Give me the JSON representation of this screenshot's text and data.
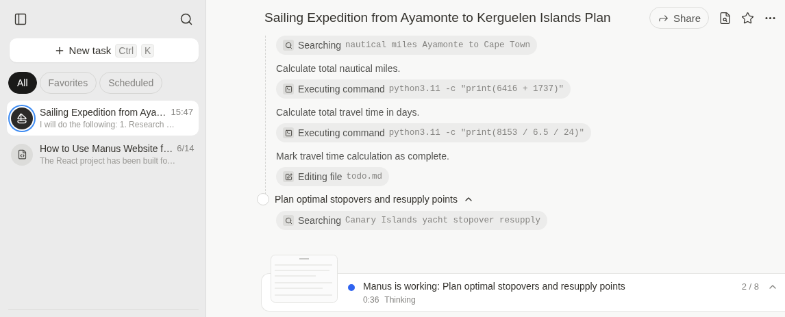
{
  "sidebar": {
    "new_task": {
      "label": "New task",
      "shortcut": [
        "Ctrl",
        "K"
      ]
    },
    "filters": [
      {
        "label": "All",
        "selected": true
      },
      {
        "label": "Favorites",
        "selected": false
      },
      {
        "label": "Scheduled",
        "selected": false
      }
    ],
    "tasks": [
      {
        "title": "Sailing Expedition from Aya…",
        "time": "15:47",
        "preview": "I will do the following: 1. Research …",
        "selected": true,
        "running": true
      },
      {
        "title": "How to Use Manus Website f…",
        "time": "6/14",
        "preview": "The React project has been built fo…",
        "selected": false,
        "running": false
      }
    ]
  },
  "header": {
    "title": "Sailing Expedition from Ayamonte to Kerguelen Islands Plan",
    "share": "Share"
  },
  "timeline": [
    {
      "kind": "search",
      "action": "Searching",
      "arg": "nautical miles Ayamonte to Cape Town"
    },
    {
      "kind": "note",
      "text": "Calculate total nautical miles."
    },
    {
      "kind": "command",
      "action": "Executing command",
      "arg": "python3.11 -c \"print(6416 + 1737)\""
    },
    {
      "kind": "note",
      "text": "Calculate total travel time in days."
    },
    {
      "kind": "command",
      "action": "Executing command",
      "arg": "python3.11 -c \"print(8153 / 6.5 / 24)\""
    },
    {
      "kind": "note",
      "text": "Mark travel time calculation as complete."
    },
    {
      "kind": "edit",
      "action": "Editing file",
      "arg": "todo.md"
    }
  ],
  "task": {
    "title": "Plan optimal stopovers and resupply points",
    "expanded": true,
    "completed": false,
    "steps": [
      {
        "kind": "search",
        "action": "Searching",
        "arg": "Canary Islands yacht stopover resupply"
      }
    ]
  },
  "status": {
    "message": "Manus is working: Plan optimal stopovers and resupply points",
    "elapsed": "0:36",
    "state": "Thinking",
    "progress": "2 / 8",
    "expanded": true
  }
}
